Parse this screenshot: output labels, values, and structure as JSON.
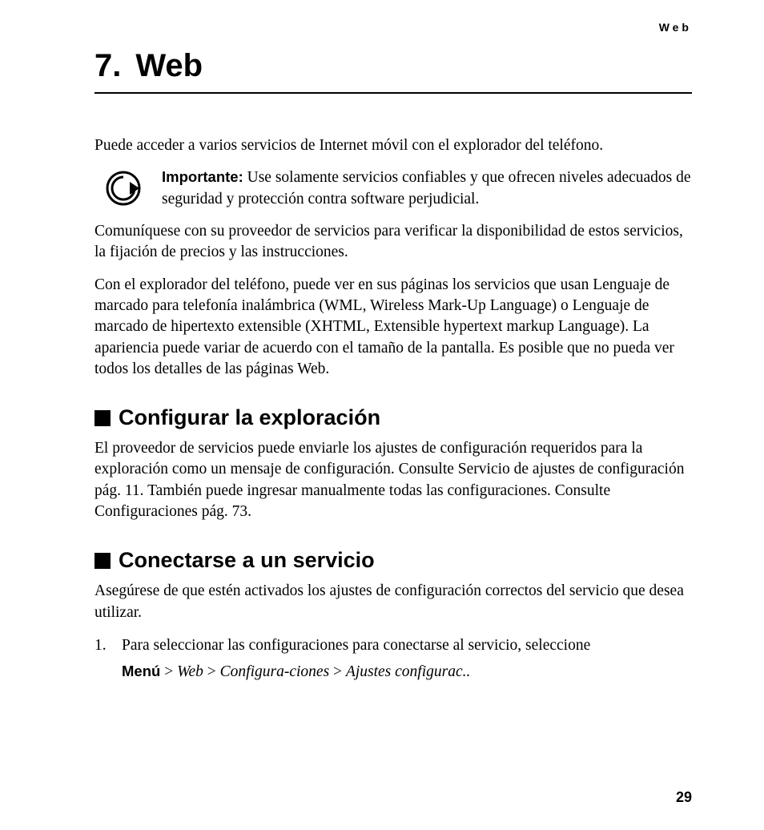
{
  "header": {
    "running": "Web"
  },
  "chapter": {
    "number": "7.",
    "title": "Web"
  },
  "intro": "Puede acceder a varios servicios de Internet móvil con el explorador del teléfono.",
  "important": {
    "label": "Importante:",
    "text": "Use solamente servicios confiables y que ofrecen niveles adecuados de seguridad y protección contra software perjudicial."
  },
  "para2": "Comuníquese con su proveedor de servicios para verificar la disponibilidad de estos servicios, la fijación de precios y las instrucciones.",
  "para3": "Con el explorador del teléfono, puede ver en sus páginas los servicios que usan Lenguaje de marcado para telefonía inalámbrica (WML, Wireless Mark-Up Language) o Lenguaje de marcado de hipertexto extensible (XHTML, Extensible hypertext markup Language). La apariencia puede variar de acuerdo con el tamaño de la pantalla. Es posible que no pueda ver todos los detalles de las páginas Web.",
  "section1": {
    "title": "Configurar la exploración",
    "body": "El proveedor de servicios puede enviarle los ajustes de configuración requeridos para la exploración como un mensaje de configuración. Consulte Servicio de ajustes de configuración pág. 11. También puede ingresar manualmente todas las configuraciones. Consulte Configuraciones pág. 73."
  },
  "section2": {
    "title": "Conectarse a un servicio",
    "body": "Asegúrese de que estén activados los ajustes de configuración correctos del servicio que desea utilizar.",
    "step1_num": "1.",
    "step1_text": "Para seleccionar las configuraciones para conectarse al servicio, seleccione",
    "menu": {
      "m1": "Menú",
      "sep": " > ",
      "m2": "Web",
      "m3": "Configura-ciones",
      "m4": "Ajustes configurac.."
    }
  },
  "page_number": "29"
}
